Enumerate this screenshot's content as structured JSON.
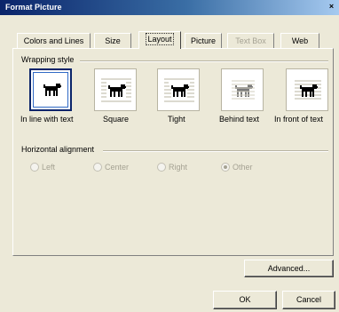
{
  "window": {
    "title": "Format Picture"
  },
  "tabs": [
    {
      "label": "Colors and Lines",
      "state": "normal"
    },
    {
      "label": "Size",
      "state": "normal"
    },
    {
      "label": "Layout",
      "state": "active"
    },
    {
      "label": "Picture",
      "state": "normal"
    },
    {
      "label": "Text Box",
      "state": "disabled"
    },
    {
      "label": "Web",
      "state": "normal"
    }
  ],
  "wrapping": {
    "heading": "Wrapping style",
    "options": [
      {
        "label": "In line with text",
        "icon": "dog-inline-icon",
        "selected": true
      },
      {
        "label": "Square",
        "icon": "dog-square-icon",
        "selected": false
      },
      {
        "label": "Tight",
        "icon": "dog-tight-icon",
        "selected": false
      },
      {
        "label": "Behind text",
        "icon": "dog-behind-text-icon",
        "selected": false
      },
      {
        "label": "In front of text",
        "icon": "dog-in-front-icon",
        "selected": false
      }
    ]
  },
  "alignment": {
    "heading": "Horizontal alignment",
    "options": [
      {
        "label": "Left",
        "checked": false
      },
      {
        "label": "Center",
        "checked": false
      },
      {
        "label": "Right",
        "checked": false
      },
      {
        "label": "Other",
        "checked": true
      }
    ],
    "enabled": false
  },
  "buttons": {
    "advanced": "Advanced...",
    "ok": "OK",
    "cancel": "Cancel"
  },
  "colors": {
    "face": "#ece9d8",
    "title_gradient_start": "#0a246a",
    "selected_border": "#0a246a",
    "disabled_text": "#a5a293"
  }
}
